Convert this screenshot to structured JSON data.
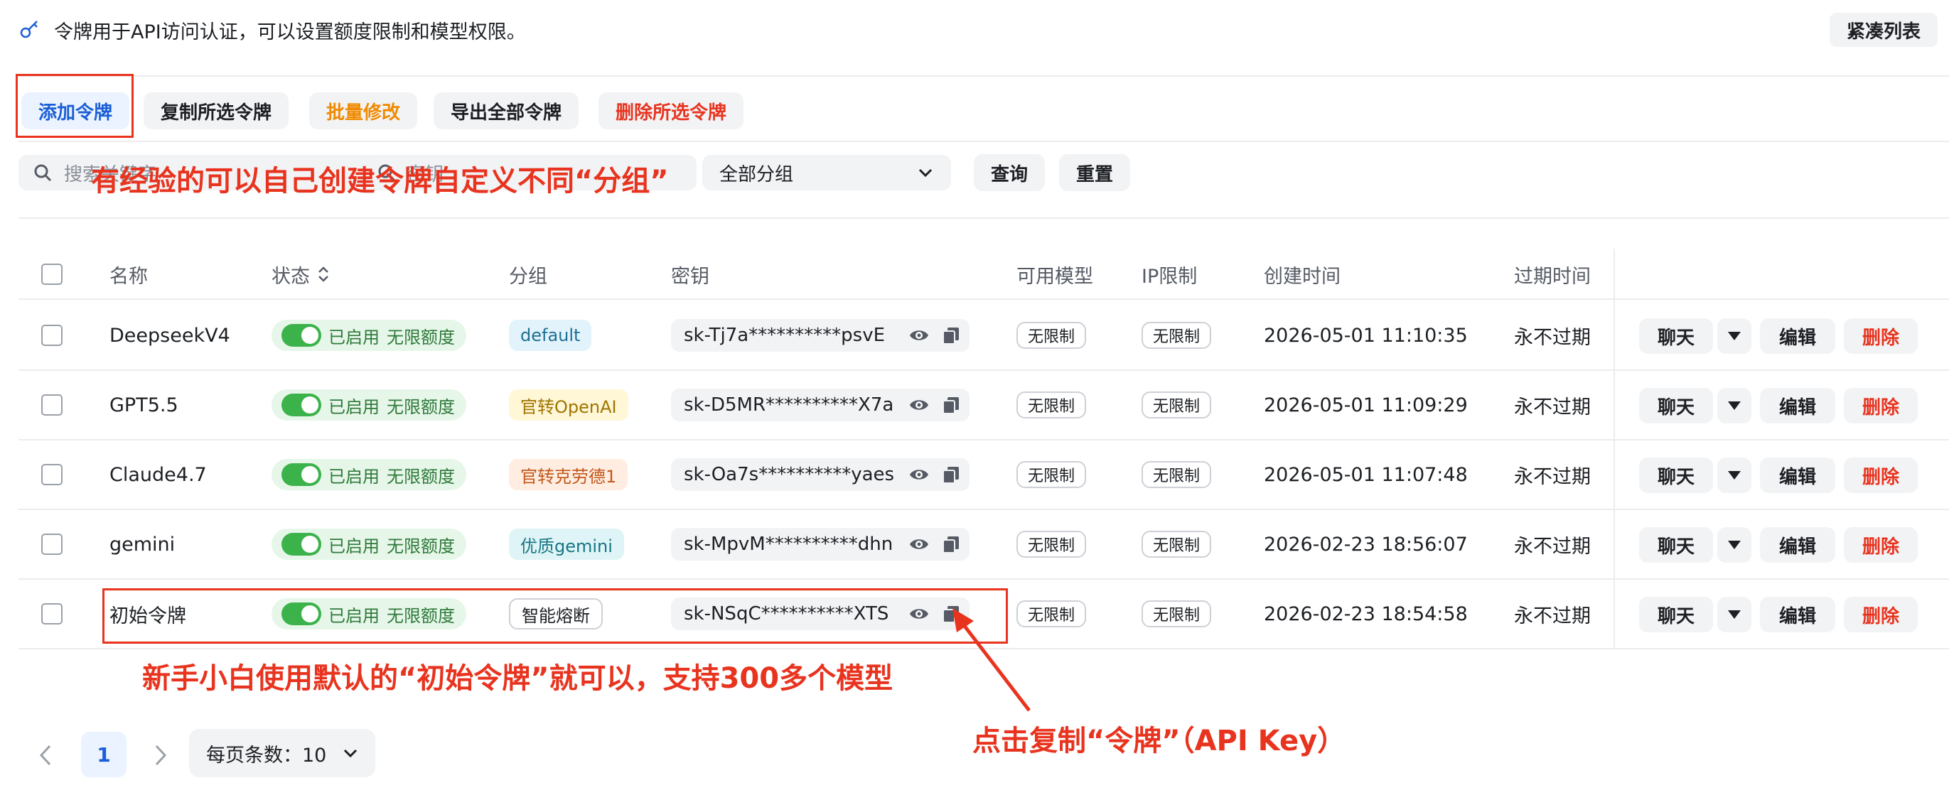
{
  "info": {
    "text": "令牌用于API访问认证，可以设置额度限制和模型权限。",
    "icon": "key-icon"
  },
  "toolbar": {
    "compact_label": "紧凑列表",
    "add_label": "添加令牌",
    "copy_selected_label": "复制所选令牌",
    "batch_edit_label": "批量修改",
    "export_all_label": "导出全部令牌",
    "delete_selected_label": "删除所选令牌"
  },
  "filters": {
    "search_placeholder": "搜索关键字",
    "search2_placeholder": "密钥",
    "group_value": "全部分组",
    "query_label": "查询",
    "reset_label": "重置"
  },
  "table": {
    "headers": {
      "name": "名称",
      "status": "状态",
      "group": "分组",
      "key": "密钥",
      "models": "可用模型",
      "ip": "IP限制",
      "created": "创建时间",
      "expires": "过期时间"
    },
    "rows": [
      {
        "name": "DeepseekV4",
        "status": "已启用",
        "quota": "无限额度",
        "group": "default",
        "key": "sk-Tj7a**********psvE",
        "models": "无限制",
        "ip": "无限制",
        "created": "2026-05-01 11:10:35",
        "expires": "永不过期",
        "chat": "聊天",
        "edit": "编辑",
        "delete": "删除"
      },
      {
        "name": "GPT5.5",
        "status": "已启用",
        "quota": "无限额度",
        "group": "官转OpenAI",
        "key": "sk-D5MR**********X7a",
        "models": "无限制",
        "ip": "无限制",
        "created": "2026-05-01 11:09:29",
        "expires": "永不过期",
        "chat": "聊天",
        "edit": "编辑",
        "delete": "删除"
      },
      {
        "name": "Claude4.7",
        "status": "已启用",
        "quota": "无限额度",
        "group": "官转克劳德1",
        "key": "sk-Oa7s**********yaes",
        "models": "无限制",
        "ip": "无限制",
        "created": "2026-05-01 11:07:48",
        "expires": "永不过期",
        "chat": "聊天",
        "edit": "编辑",
        "delete": "删除"
      },
      {
        "name": "gemini",
        "status": "已启用",
        "quota": "无限额度",
        "group": "优质gemini",
        "key": "sk-MpvM**********dhn",
        "models": "无限制",
        "ip": "无限制",
        "created": "2026-02-23 18:56:07",
        "expires": "永不过期",
        "chat": "聊天",
        "edit": "编辑",
        "delete": "删除"
      },
      {
        "name": "初始令牌",
        "status": "已启用",
        "quota": "无限额度",
        "group": "智能熔断",
        "key": "sk-NSqC**********XTS",
        "models": "无限制",
        "ip": "无限制",
        "created": "2026-02-23 18:54:58",
        "expires": "永不过期",
        "chat": "聊天",
        "edit": "编辑",
        "delete": "删除"
      }
    ]
  },
  "pagination": {
    "current_page": "1",
    "page_size_label": "每页条数：10"
  },
  "annotations": {
    "top": "有经验的可以自己创建令牌自定义不同“分组”",
    "middle": "新手小白使用默认的“初始令牌”就可以，支持300多个模型",
    "bottom": "点击复制“令牌”（API Key）"
  },
  "colors": {
    "accent_blue": "#1a5fd6",
    "warning_orange": "#f08a00",
    "danger_red": "#e8341f",
    "success_green": "#3bb34a"
  }
}
